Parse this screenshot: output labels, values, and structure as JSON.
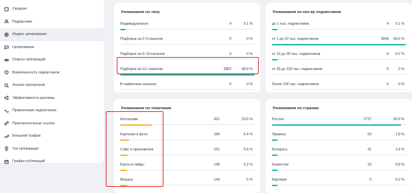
{
  "sidebar": {
    "items": [
      {
        "label": "Сводная",
        "icon": "grid-icon"
      },
      {
        "label": "Подписчики",
        "icon": "users-icon"
      },
      {
        "label": "Индекс цитирования",
        "icon": "target-icon",
        "active": true
      },
      {
        "label": "Цитирование",
        "icon": "quote-icon"
      },
      {
        "label": "Охваты публикаций",
        "icon": "eye-icon"
      },
      {
        "label": "Вовлеченность подписчиков",
        "icon": "heart-icon"
      },
      {
        "label": "Анализ просмотров",
        "icon": "search-icon"
      },
      {
        "label": "Эффективность рекламы",
        "icon": "megaphone-icon"
      },
      {
        "label": "Привлечение подписчиков",
        "icon": "wave-icon"
      },
      {
        "label": "Пригласительные ссылки",
        "icon": "link-icon"
      },
      {
        "label": "Внешний трафик",
        "icon": "trend-icon"
      },
      {
        "label": "Топ публикаций",
        "icon": "trophy-icon"
      },
      {
        "label": "График публикаций",
        "icon": "calendar-icon"
      }
    ]
  },
  "cards": {
    "by_type": {
      "title": "Упоминания по типу",
      "rows": [
        {
          "label": "Индивидуальное",
          "count": "4",
          "percent": "0.1 %",
          "share": 0.001
        },
        {
          "label": "Подборка на 2–5 каналов",
          "count": "0",
          "percent": "0 %",
          "share": 0
        },
        {
          "label": "Подборка на 6–10 каналов",
          "count": "0",
          "percent": "0 %",
          "share": 0
        },
        {
          "label": "Подборка на 11+ каналов",
          "count": "2852",
          "percent": "99.9 %",
          "share": 0.999
        },
        {
          "label": "В наёмочных каналах",
          "count": "0",
          "percent": "0 %",
          "share": 0
        }
      ]
    },
    "by_subscribers": {
      "title": "Упоминания по кол-ву подписчиков",
      "rows": [
        {
          "label": "до 1 тыс. подписчиков",
          "count": "4",
          "percent": "0.1 %",
          "share": 0.001
        },
        {
          "label": "от 1 до 10 тыс. подписчиков",
          "count": "2848",
          "percent": "99.6 %",
          "share": 0.996
        },
        {
          "label": "от 10 до 30 тыс. подписчиков",
          "count": "8",
          "percent": "0.2 %",
          "share": 0.002
        },
        {
          "label": "от 30 до 100 тыс. подписчиков",
          "count": "0",
          "percent": "0 %",
          "share": 0
        },
        {
          "label": "более 100 тыс. подписчиков",
          "count": "0",
          "percent": "0 %",
          "share": 0
        }
      ]
    },
    "by_topic": {
      "title": "Упоминания по тематикам",
      "rows": [
        {
          "label": "Инстаграм",
          "count": "661",
          "percent": "23.6 %",
          "share": 0.236
        },
        {
          "label": "Картинки и фото",
          "count": "184",
          "percent": "6.4 %",
          "share": 0.064
        },
        {
          "label": "Софт и приложения",
          "count": "161",
          "percent": "5.6 %",
          "share": 0.056
        },
        {
          "label": "Курсы и гайды",
          "count": "148",
          "percent": "5.2 %",
          "share": 0.052
        },
        {
          "label": "Музыка",
          "count": "143",
          "percent": "5 %",
          "share": 0.05
        }
      ]
    },
    "by_country": {
      "title": "Упоминания по странам",
      "rows": [
        {
          "label": "Россия",
          "count": "2737",
          "percent": "95.8 %",
          "share": 0.958
        },
        {
          "label": "Украина",
          "count": "50",
          "percent": "1.8 %",
          "share": 0.018
        },
        {
          "label": "Беларусь",
          "count": "41",
          "percent": "1.4 %",
          "share": 0.014
        },
        {
          "label": "Казахстан",
          "count": "22",
          "percent": "0.8 %",
          "share": 0.008
        },
        {
          "label": "Киргизия",
          "count": "5",
          "percent": "0.2 %",
          "share": 0.002
        }
      ]
    }
  },
  "colors": {
    "bar_teal": "#1fb5a8",
    "bar_orange": "#f5b72e",
    "highlight_red": "#e02424"
  }
}
